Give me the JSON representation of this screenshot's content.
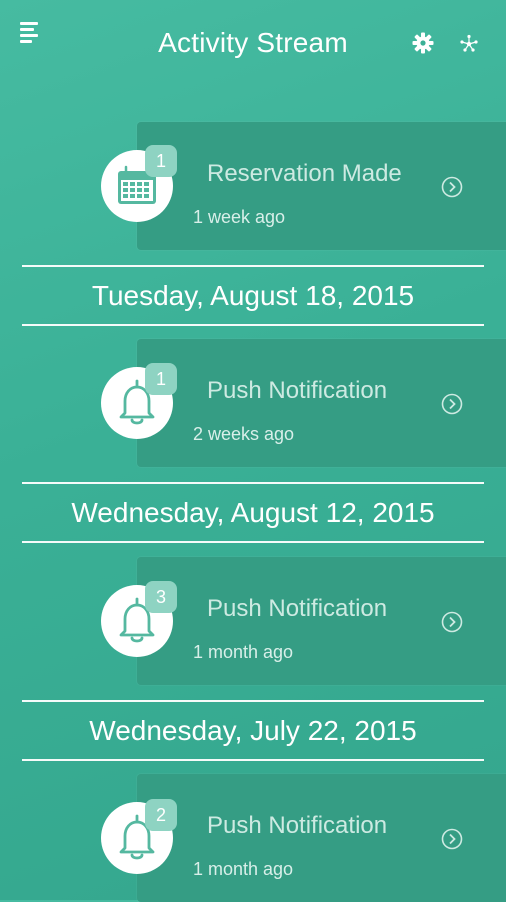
{
  "header": {
    "title": "Activity Stream"
  },
  "groups": [
    {
      "date": "",
      "item": {
        "title": "Reservation Made",
        "time": "1 week ago",
        "badge": "1",
        "icon": "calendar-icon"
      }
    },
    {
      "date": "Tuesday, August 18, 2015",
      "item": {
        "title": "Push Notification",
        "time": "2 weeks ago",
        "badge": "1",
        "icon": "bell-icon"
      }
    },
    {
      "date": "Wednesday, August 12, 2015",
      "item": {
        "title": "Push Notification",
        "time": "1 month ago",
        "badge": "3",
        "icon": "bell-icon"
      }
    },
    {
      "date": "Wednesday, July 22, 2015",
      "item": {
        "title": "Push Notification",
        "time": "1 month ago",
        "badge": "2",
        "icon": "bell-icon"
      }
    }
  ],
  "colors": {
    "background": "#3ab096",
    "card": "#359d84",
    "icon_teal": "#55b8a0",
    "badge": "#8ed3c2"
  }
}
